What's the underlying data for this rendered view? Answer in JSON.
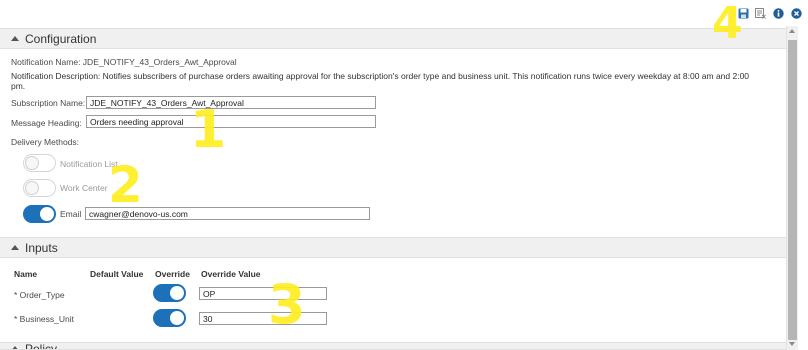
{
  "toolbar": {
    "icons": [
      "save-icon",
      "save-list-icon",
      "info-icon",
      "close-icon"
    ],
    "accent": "#1d71b8"
  },
  "configuration": {
    "title": "Configuration",
    "notification_name": "Notification Name: JDE_NOTIFY_43_Orders_Awt_Approval",
    "notification_description_line1": "Notification Description: Notifies subscribers of purchase orders awaiting approval for the subscription's order type and business unit. This notification runs twice every weekday at 8:00 am and 2:00",
    "notification_description_line2": "pm.",
    "subscription_name_label": "Subscription Name:",
    "subscription_name_value": "JDE_NOTIFY_43_Orders_Awt_Approval",
    "message_heading_label": "Message Heading:",
    "message_heading_value": "Orders needing approval",
    "delivery_methods_label": "Delivery Methods:",
    "delivery": [
      {
        "label": "Notification List",
        "enabled": false
      },
      {
        "label": "Work Center",
        "enabled": false
      },
      {
        "label": "Email",
        "enabled": true,
        "value": "cwagner@denovo-us.com"
      }
    ]
  },
  "inputs": {
    "title": "Inputs",
    "columns": [
      "Name",
      "Default Value",
      "Override",
      "Override Value"
    ],
    "rows": [
      {
        "name": "* Order_Type",
        "override": true,
        "override_value": "OP"
      },
      {
        "name": "* Business_Unit",
        "override": true,
        "override_value": "30"
      }
    ]
  },
  "next_section": {
    "title": "Policy"
  },
  "annotations": [
    "1",
    "2",
    "3",
    "4"
  ]
}
